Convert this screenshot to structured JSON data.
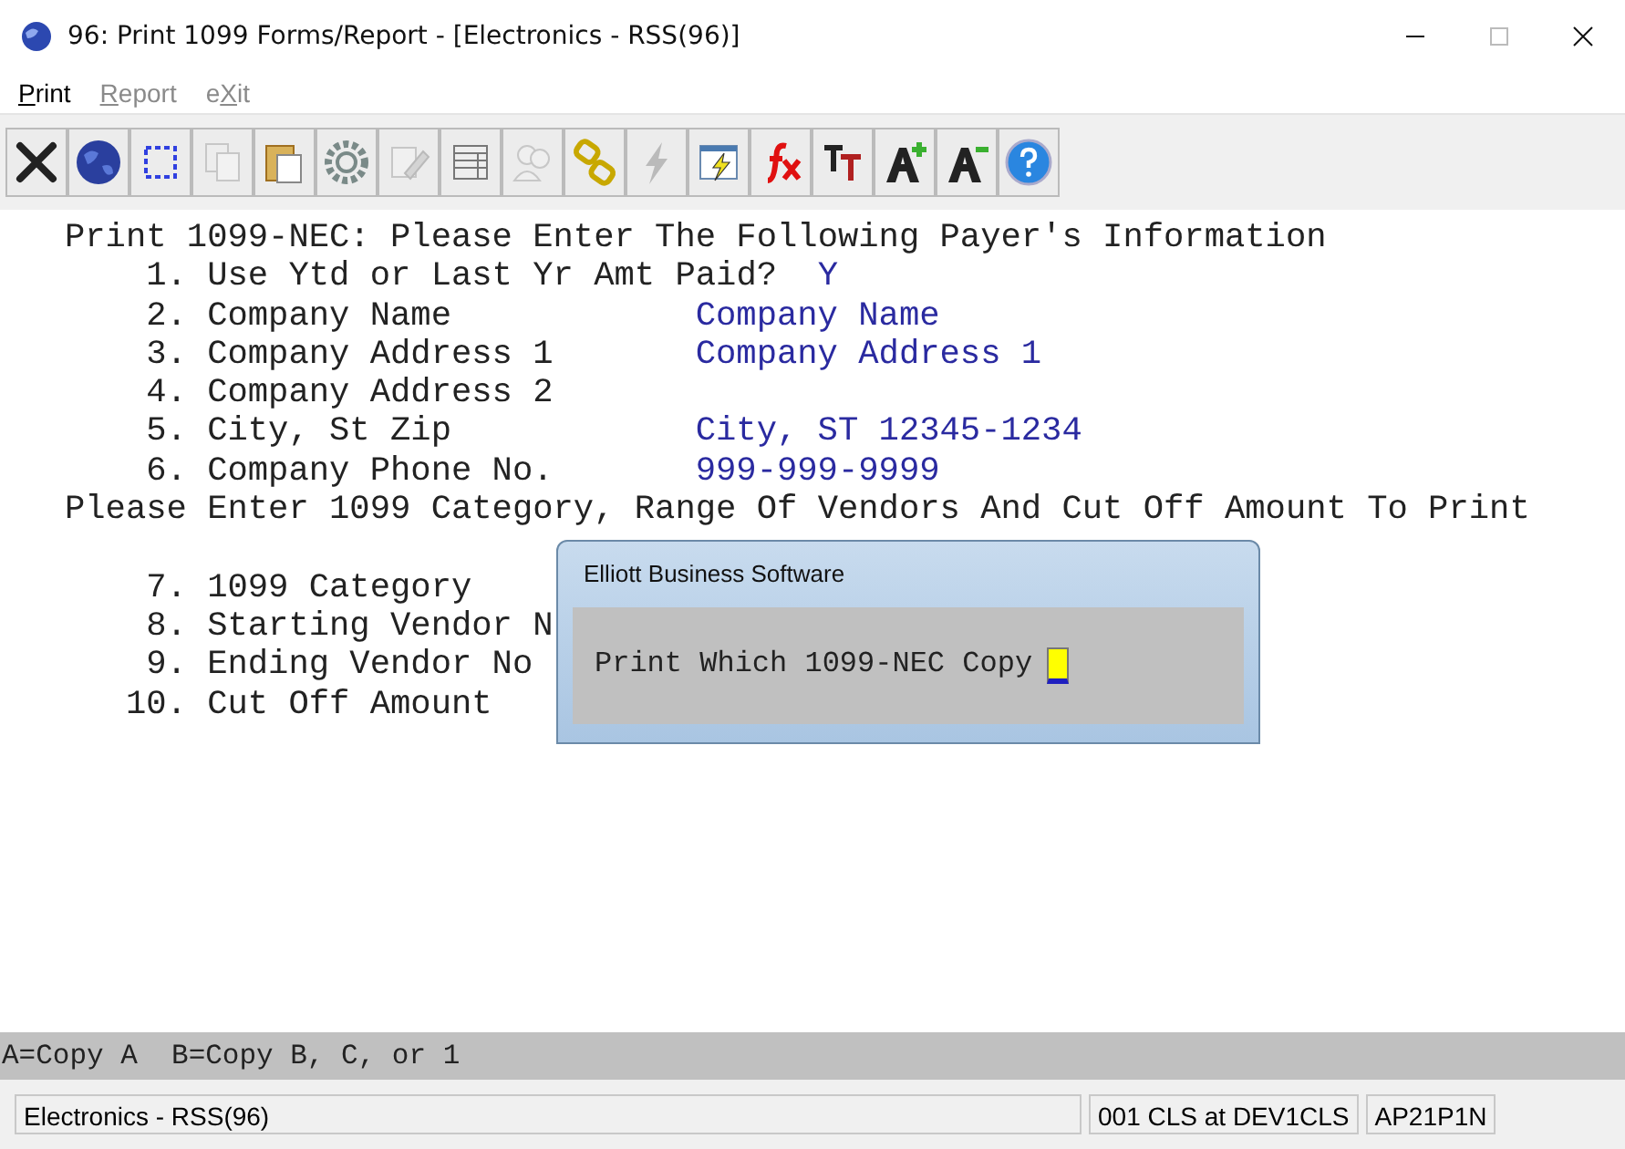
{
  "window": {
    "title": "96: Print 1099 Forms/Report - [Electronics - RSS(96)]"
  },
  "menu": [
    {
      "key": "P",
      "post": "rint",
      "disabled": false
    },
    {
      "key": "R",
      "post": "eport",
      "disabled": true
    },
    {
      "pre": "e",
      "key": "X",
      "post": "it",
      "disabled": true
    }
  ],
  "toolbar": [
    {
      "kind": "close",
      "disabled": false
    },
    {
      "kind": "globe",
      "disabled": false
    },
    {
      "kind": "select",
      "disabled": false
    },
    {
      "kind": "copy",
      "disabled": true
    },
    {
      "kind": "paste",
      "disabled": false
    },
    {
      "kind": "gear",
      "disabled": false
    },
    {
      "kind": "edit",
      "disabled": true
    },
    {
      "kind": "table",
      "disabled": false
    },
    {
      "kind": "people",
      "disabled": true
    },
    {
      "kind": "chain",
      "disabled": false
    },
    {
      "kind": "lightning",
      "disabled": true
    },
    {
      "kind": "run",
      "disabled": false
    },
    {
      "kind": "fx",
      "disabled": false
    },
    {
      "kind": "font",
      "disabled": false
    },
    {
      "kind": "grow",
      "disabled": false
    },
    {
      "kind": "shrink",
      "disabled": false
    },
    {
      "kind": "help",
      "disabled": false
    }
  ],
  "screen": [
    {
      "kind": "heading",
      "text": "Print 1099-NEC: Please Enter The Following Payer's Information"
    },
    {
      "kind": "question",
      "number": "1.",
      "label": "Use Ytd or Last Yr Amt Paid?",
      "value": "Y"
    },
    {
      "kind": "field",
      "number": "2.",
      "label": "Company Name",
      "value": "Company Name"
    },
    {
      "kind": "field",
      "number": "3.",
      "label": "Company Address 1",
      "value": "Company Address 1"
    },
    {
      "kind": "field",
      "number": "4.",
      "label": "Company Address 2"
    },
    {
      "kind": "field",
      "number": "5.",
      "label": "City, St Zip",
      "value": "City, ST 12345-1234"
    },
    {
      "kind": "field",
      "number": "6.",
      "label": "Company Phone No.",
      "value": "999-999-9999"
    },
    {
      "kind": "heading",
      "text": "Please Enter 1099 Category, Range Of Vendors And Cut Off Amount To Print"
    },
    {
      "kind": "blank"
    },
    {
      "kind": "field",
      "number": "7.",
      "label": "1099 Category"
    },
    {
      "kind": "field",
      "number": "8.",
      "label": "Starting Vendor N"
    },
    {
      "kind": "field",
      "number": "9.",
      "label": "Ending Vendor No"
    },
    {
      "kind": "field",
      "number": "10.",
      "label": "Cut Off Amount"
    }
  ],
  "dialog": {
    "title": "Elliott Business Software",
    "prompt": "Print Which 1099-NEC Copy"
  },
  "hint": "A=Copy A  B=Copy B, C, or 1",
  "status_bar": [
    "Electronics - RSS(96)",
    "001 CLS at DEV1CLS",
    "AP21P1N"
  ]
}
